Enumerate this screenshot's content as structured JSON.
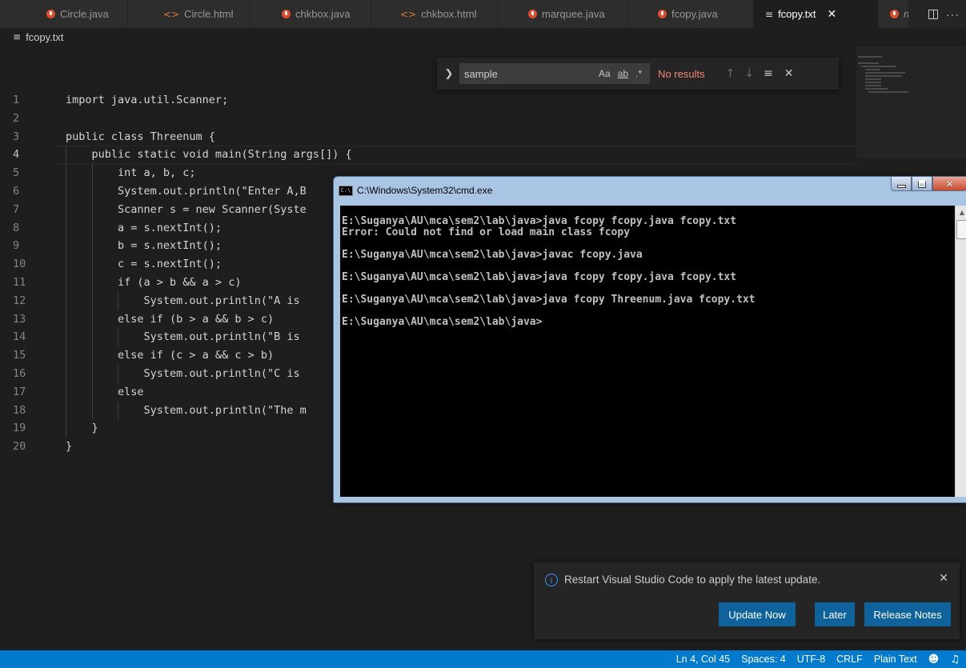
{
  "tabs": [
    {
      "label": "Circle.java",
      "icon": "java-icon"
    },
    {
      "label": "Circle.html",
      "icon": "html-icon"
    },
    {
      "label": "chkbox.java",
      "icon": "java-icon"
    },
    {
      "label": "chkbox.html",
      "icon": "html-icon"
    },
    {
      "label": "marquee.java",
      "icon": "java-icon"
    },
    {
      "label": "fcopy.java",
      "icon": "java-icon"
    },
    {
      "label": "fcopy.txt",
      "icon": "text-file-icon",
      "active": true
    },
    {
      "label": "n",
      "icon": "java-icon"
    }
  ],
  "breadcrumb": "fcopy.txt",
  "find": {
    "query": "sample",
    "match_case": "Aa",
    "whole_word": "ab",
    "regex": ".*",
    "results": "No results"
  },
  "editor": {
    "lines": [
      {
        "n": "1",
        "text": "import java.util.Scanner;"
      },
      {
        "n": "2",
        "text": ""
      },
      {
        "n": "3",
        "text": "public class Threenum {"
      },
      {
        "n": "4",
        "text": "    public static void main(String args[]) {"
      },
      {
        "n": "5",
        "text": "        int a, b, c;"
      },
      {
        "n": "6",
        "text": "        System.out.println(\"Enter A,B"
      },
      {
        "n": "7",
        "text": "        Scanner s = new Scanner(Syste"
      },
      {
        "n": "8",
        "text": "        a = s.nextInt();"
      },
      {
        "n": "9",
        "text": "        b = s.nextInt();"
      },
      {
        "n": "10",
        "text": "        c = s.nextInt();"
      },
      {
        "n": "11",
        "text": "        if (a > b && a > c)"
      },
      {
        "n": "12",
        "text": "            System.out.println(\"A is"
      },
      {
        "n": "13",
        "text": "        else if (b > a && b > c)"
      },
      {
        "n": "14",
        "text": "            System.out.println(\"B is"
      },
      {
        "n": "15",
        "text": "        else if (c > a && c > b)"
      },
      {
        "n": "16",
        "text": "            System.out.println(\"C is"
      },
      {
        "n": "17",
        "text": "        else"
      },
      {
        "n": "18",
        "text": "            System.out.println(\"The m"
      },
      {
        "n": "19",
        "text": "    }"
      },
      {
        "n": "20",
        "text": "}"
      }
    ]
  },
  "cmd": {
    "title": "C:\\Windows\\System32\\cmd.exe",
    "icon_text": "C:\\",
    "output": "E:\\Suganya\\AU\\mca\\sem2\\lab\\java>java fcopy fcopy.java fcopy.txt\nError: Could not find or load main class fcopy\n\nE:\\Suganya\\AU\\mca\\sem2\\lab\\java>javac fcopy.java\n\nE:\\Suganya\\AU\\mca\\sem2\\lab\\java>java fcopy fcopy.java fcopy.txt\n\nE:\\Suganya\\AU\\mca\\sem2\\lab\\java>java fcopy Threenum.java fcopy.txt\n\nE:\\Suganya\\AU\\mca\\sem2\\lab\\java>"
  },
  "notification": {
    "message": "Restart Visual Studio Code to apply the latest update.",
    "buttons": [
      "Update Now",
      "Later",
      "Release Notes"
    ]
  },
  "status": {
    "position": "Ln 4, Col 45",
    "spaces": "Spaces: 4",
    "encoding": "UTF-8",
    "eol": "CRLF",
    "language": "Plain Text"
  },
  "colors": {
    "accent": "#007acc",
    "button": "#0e639c",
    "no_results": "#f48771",
    "java_icon": "#e34c2a",
    "html_icon": "#e37933"
  }
}
